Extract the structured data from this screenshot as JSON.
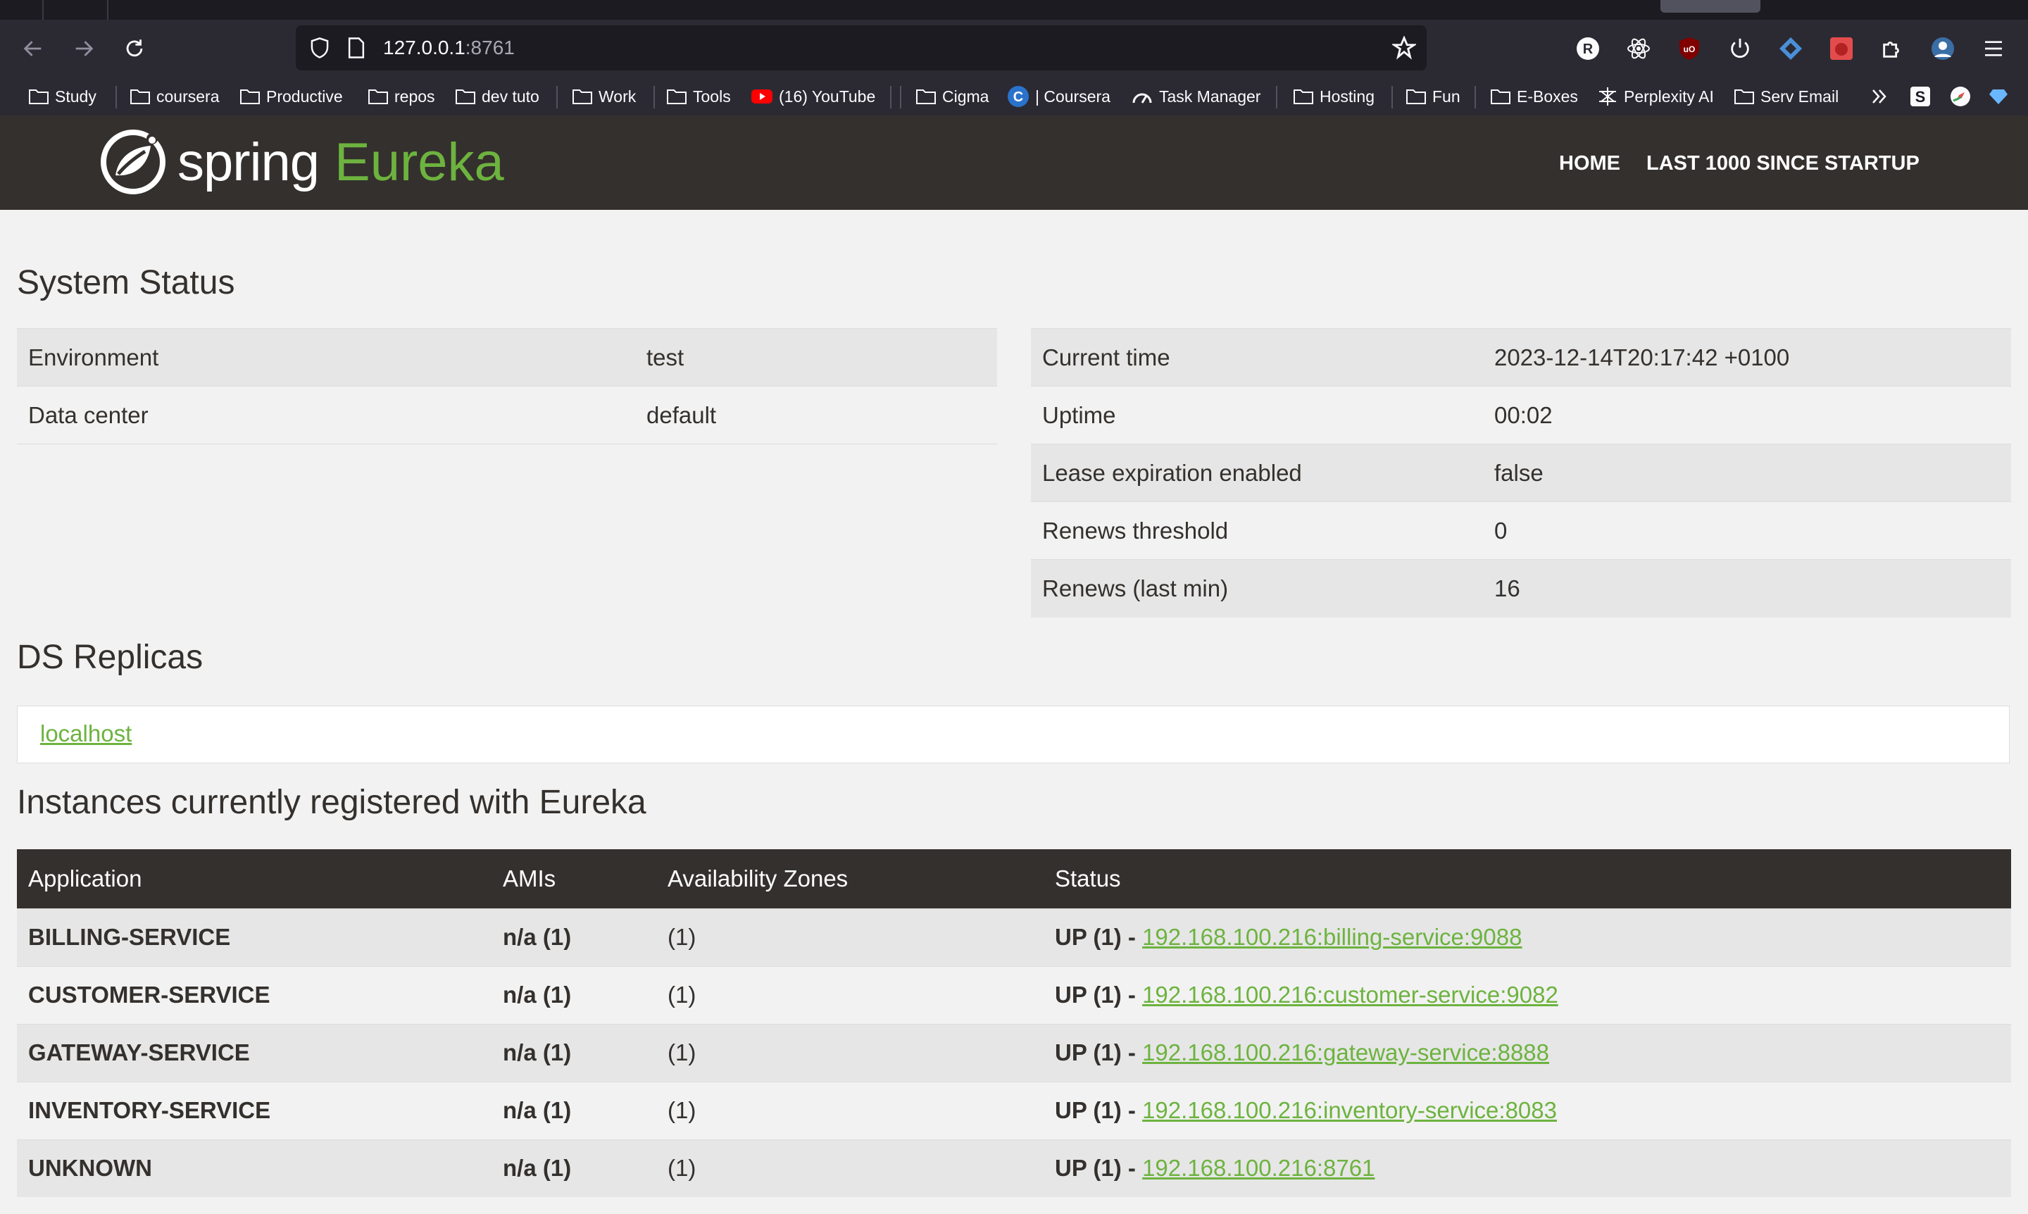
{
  "browser": {
    "url_host": "127.0.0.1",
    "url_port": ":8761",
    "bookmarks": [
      {
        "label": "Study",
        "icon": "folder-icon"
      },
      {
        "label": "coursera",
        "icon": "folder-icon"
      },
      {
        "label": "Productive",
        "icon": "folder-icon"
      },
      {
        "label": "repos",
        "icon": "folder-icon"
      },
      {
        "label": "dev tuto",
        "icon": "folder-icon"
      },
      {
        "label": "Work",
        "icon": "folder-icon"
      },
      {
        "label": "Tools",
        "icon": "folder-icon"
      },
      {
        "label": "(16) YouTube",
        "icon": "youtube-icon"
      },
      {
        "label": "Cigma",
        "icon": "folder-icon"
      },
      {
        "label": "| Coursera",
        "icon": "coursera-icon"
      },
      {
        "label": "Task Manager",
        "icon": "gauge-icon"
      },
      {
        "label": "Hosting",
        "icon": "folder-icon"
      },
      {
        "label": "Fun",
        "icon": "folder-icon"
      },
      {
        "label": "E-Boxes",
        "icon": "folder-icon"
      },
      {
        "label": "Perplexity AI",
        "icon": "perplexity-icon"
      },
      {
        "label": "Serv Email",
        "icon": "folder-icon"
      }
    ]
  },
  "navbar": {
    "brand_spring": "spring",
    "brand_eureka": "Eureka",
    "home": "HOME",
    "last1000": "LAST 1000 SINCE STARTUP"
  },
  "system_status": {
    "title": "System Status",
    "left": [
      {
        "key": "Environment",
        "value": "test"
      },
      {
        "key": "Data center",
        "value": "default"
      }
    ],
    "right": [
      {
        "key": "Current time",
        "value": "2023-12-14T20:17:42 +0100"
      },
      {
        "key": "Uptime",
        "value": "00:02"
      },
      {
        "key": "Lease expiration enabled",
        "value": "false"
      },
      {
        "key": "Renews threshold",
        "value": "0"
      },
      {
        "key": "Renews (last min)",
        "value": "16"
      }
    ]
  },
  "ds_replicas": {
    "title": "DS Replicas",
    "link": "localhost"
  },
  "instances": {
    "title": "Instances currently registered with Eureka",
    "headers": [
      "Application",
      "AMIs",
      "Availability Zones",
      "Status"
    ],
    "rows": [
      {
        "app": "BILLING-SERVICE",
        "amis": "n/a (1)",
        "zones": "(1)",
        "status": "UP (1) - ",
        "link": "192.168.100.216:billing-service:9088"
      },
      {
        "app": "CUSTOMER-SERVICE",
        "amis": "n/a (1)",
        "zones": "(1)",
        "status": "UP (1) - ",
        "link": "192.168.100.216:customer-service:9082"
      },
      {
        "app": "GATEWAY-SERVICE",
        "amis": "n/a (1)",
        "zones": "(1)",
        "status": "UP (1) - ",
        "link": "192.168.100.216:gateway-service:8888"
      },
      {
        "app": "INVENTORY-SERVICE",
        "amis": "n/a (1)",
        "zones": "(1)",
        "status": "UP (1) - ",
        "link": "192.168.100.216:inventory-service:8083"
      },
      {
        "app": "UNKNOWN",
        "amis": "n/a (1)",
        "zones": "(1)",
        "status": "UP (1) - ",
        "link": "192.168.100.216:8761"
      }
    ]
  }
}
